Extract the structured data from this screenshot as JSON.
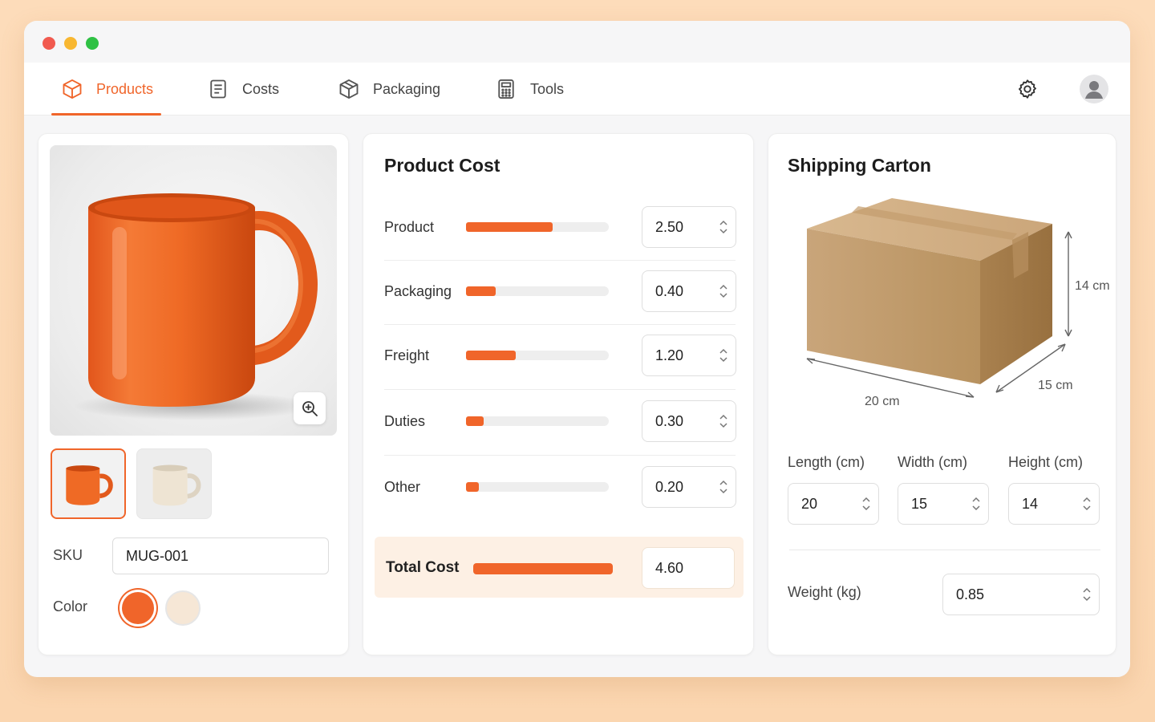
{
  "nav": {
    "tabs": [
      {
        "label": "Products",
        "icon": "cube-icon",
        "active": true
      },
      {
        "label": "Costs",
        "icon": "document-icon",
        "active": false
      },
      {
        "label": "Packaging",
        "icon": "package-icon",
        "active": false
      },
      {
        "label": "Tools",
        "icon": "calculator-icon",
        "active": false
      }
    ],
    "accent": "#f0652a"
  },
  "product": {
    "sku_label": "SKU",
    "sku_value": "MUG-001",
    "color_label": "Color",
    "colors": [
      "#f0652a",
      "#f6e7d6"
    ],
    "selected_color": "#f0652a"
  },
  "cost": {
    "title": "Product Cost",
    "rows": [
      {
        "label": "Product",
        "value": "2.50"
      },
      {
        "label": "Packaging",
        "value": "0.40"
      },
      {
        "label": "Freight",
        "value": "1.20"
      },
      {
        "label": "Duties",
        "value": "0.30"
      },
      {
        "label": "Other",
        "value": "0.20"
      }
    ],
    "total_label": "Total Cost",
    "total_value": "4.60"
  },
  "carton": {
    "title": "Shipping Carton",
    "dims_annot": {
      "length": "20 cm",
      "width": "15 cm",
      "height": "14 cm"
    },
    "length_label": "Length (cm)",
    "length_value": "20",
    "width_label": "Width (cm)",
    "width_value": "15",
    "height_label": "Height (cm)",
    "height_value": "14",
    "weight_label": "Weight (kg)",
    "weight_value": "0.85"
  }
}
